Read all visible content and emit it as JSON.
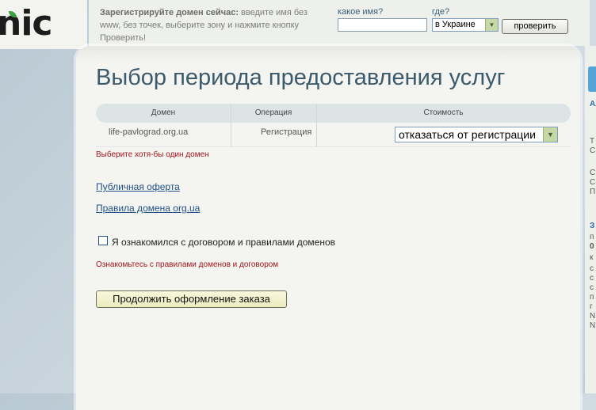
{
  "logo": {
    "text": "nic"
  },
  "promo": {
    "bold": "Зарегистрируйте домен сейчас:",
    "text": " введите имя без www, без точек, выберите зону и нажмите кнопку Проверить!"
  },
  "search": {
    "name_label": "какое имя?",
    "name_value": "",
    "zone_label": "где?",
    "zone_value": "в Украине",
    "check_button": "проверить"
  },
  "page": {
    "title": "Выбор периода предоставления услуг"
  },
  "table": {
    "headers": [
      "Домен",
      "Операция",
      "Стоимость"
    ],
    "rows": [
      {
        "domain": "life-pavlograd.org.ua",
        "operation": "Регистрация",
        "cost_select": "отказаться от регистрации"
      }
    ]
  },
  "errors": {
    "select_domain": "Выберите хотя-бы один домен",
    "agree_rules": "Ознакомьтесь с правилами доменов и договором"
  },
  "links": {
    "offer": "Публичная оферта",
    "rules": "Правила домена org.ua"
  },
  "agreement": {
    "checked": false,
    "label": "Я ознакомился с договором и правилами доменов"
  },
  "submit_button": "Продолжить оформление заказа",
  "right_edge": {
    "link": "Ал",
    "lines": [
      "Т",
      "С",
      "С",
      "С",
      "П",
      "З",
      "п",
      "0",
      "к",
      "с",
      "с",
      "с",
      "п",
      "г",
      "N",
      "N"
    ]
  }
}
